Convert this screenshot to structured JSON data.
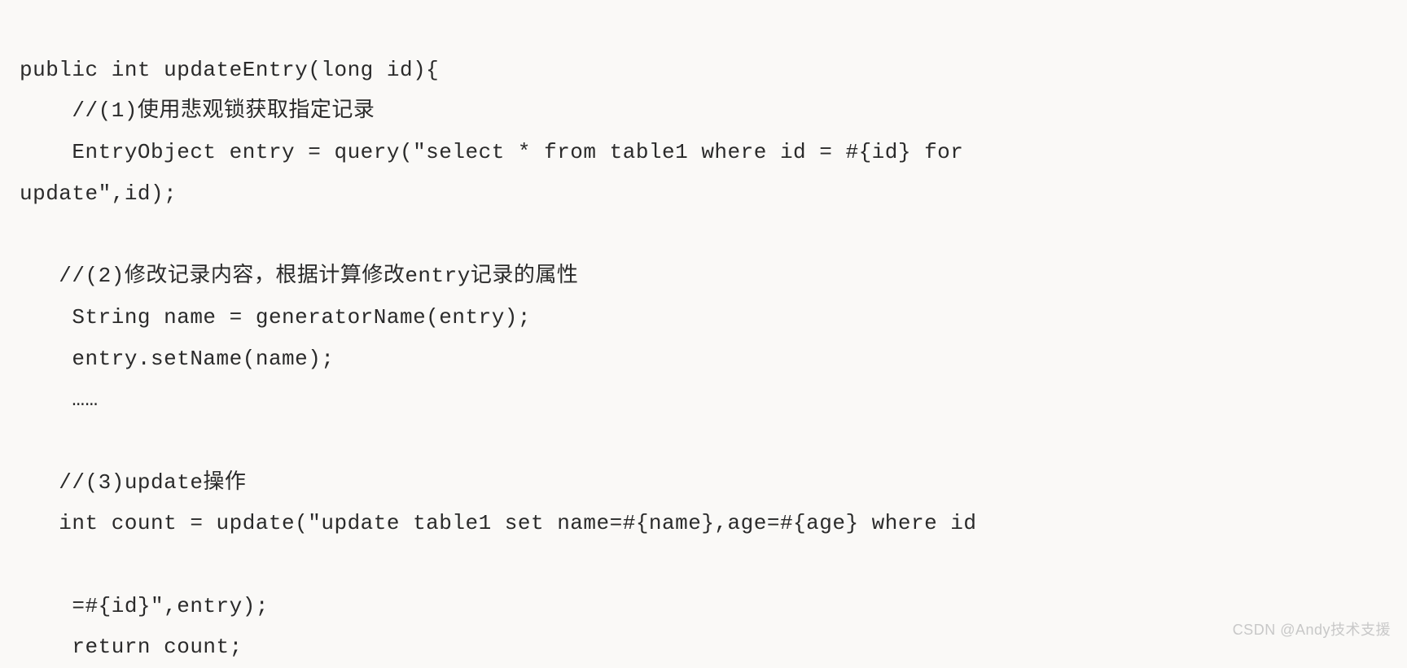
{
  "code": {
    "lines": [
      "public int updateEntry(long id){",
      "    //(1)使用悲观锁获取指定记录",
      "    EntryObject entry = query(\"select * from table1 where id = #{id} for",
      "update\",id);",
      "",
      "   //(2)修改记录内容，根据计算修改entry记录的属性",
      "    String name = generatorName(entry);",
      "    entry.setName(name);",
      "    ……",
      "",
      "   //(3)update操作",
      "   int count = update(\"update table1 set name=#{name},age=#{age} where id",
      "",
      "    =#{id}\",entry);",
      "    return count;"
    ]
  },
  "watermark": "CSDN @Andy技术支援"
}
